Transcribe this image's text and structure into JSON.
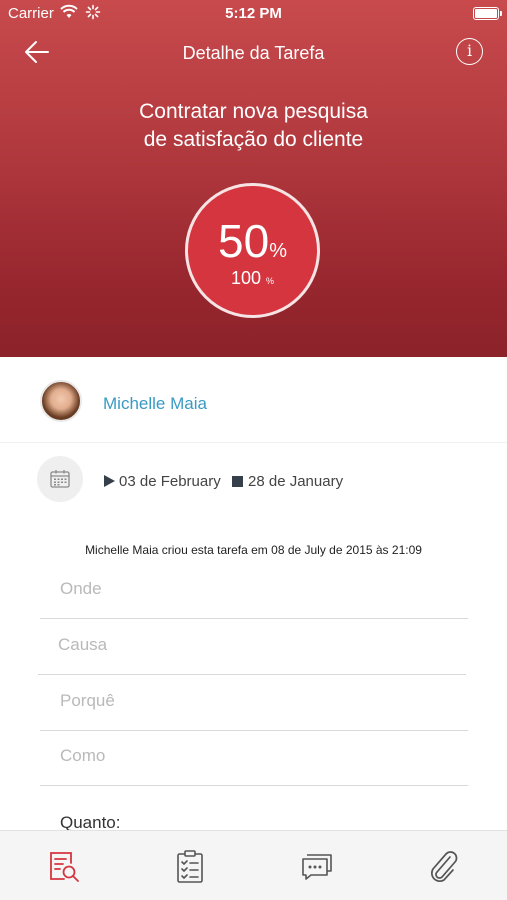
{
  "status_bar": {
    "carrier": "Carrier",
    "time": "5:12 PM"
  },
  "nav": {
    "title": "Detalhe da Tarefa",
    "info_glyph": "i"
  },
  "task": {
    "title_line1": "Contratar nova pesquisa",
    "title_line2": "de satisfação do cliente",
    "progress_value": "50",
    "progress_target": "100",
    "percent_sign": "%"
  },
  "assignee": {
    "name": "Michelle Maia"
  },
  "dates": {
    "start": "03 de February",
    "end": "28 de January"
  },
  "created_note": "Michelle Maia criou esta tarefa em 08 de July de 2015 às 21:09",
  "fields": {
    "onde": "Onde",
    "causa": "Causa",
    "porque": "Porquê",
    "como": "Como",
    "quanto": "Quanto:"
  },
  "tabbar": {
    "items": [
      "search-document-icon",
      "checklist-icon",
      "comments-icon",
      "paperclip-icon"
    ]
  },
  "colors": {
    "header_top": "#c84a4c",
    "header_bottom": "#8c222a",
    "progress_fill": "#d5353f",
    "accent_link": "#3a9ac4",
    "active_tab": "#d5353f"
  }
}
